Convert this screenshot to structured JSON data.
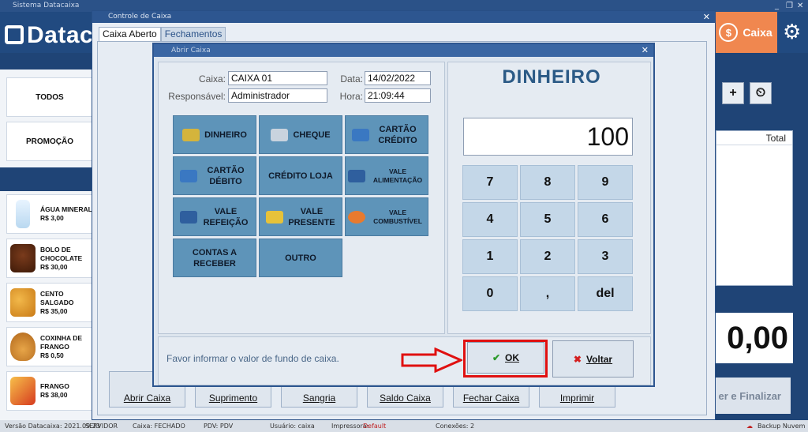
{
  "window": {
    "title": "Sistema Datacaixa"
  },
  "header": {
    "logo": "Datac",
    "caixa_label": "Caixa",
    "caixa_icon": "dollar-coin-icon",
    "settings_icon": "gear-icon",
    "accent": "#f0874f"
  },
  "sidebar": {
    "categories": [
      "TODOS",
      "PROMOÇÃO"
    ],
    "products": [
      {
        "name": "ÁGUA MINERAL",
        "price": "R$ 3,00"
      },
      {
        "name": "BOLO DE CHOCOLATE",
        "price": "R$ 30,00"
      },
      {
        "name": "CENTO SALGADO",
        "price": "R$ 35,00"
      },
      {
        "name": "COXINHA DE FRANGO",
        "price": "R$ 0,50"
      },
      {
        "name": "FRANGO",
        "price": "R$ 38,00"
      }
    ]
  },
  "right_panel": {
    "total_header": "Total",
    "total_value": "0,00",
    "finalize_label": "er e Finalizar",
    "add_label": "+",
    "scale_icon": "scale-icon"
  },
  "controle": {
    "title": "Controle de Caixa",
    "tabs": [
      "Caixa Aberto",
      "Fechamentos"
    ],
    "footer_buttons": [
      "Abrir Caixa",
      "Suprimento",
      "Sangria",
      "Saldo Caixa",
      "Fechar Caixa",
      "Imprimir"
    ]
  },
  "abrir": {
    "title": "Abrir Caixa",
    "fields": {
      "caixa_label": "Caixa:",
      "caixa_value": "CAIXA 01",
      "data_label": "Data:",
      "data_value": "14/02/2022",
      "responsavel_label": "Responsável:",
      "responsavel_value": "Administrador",
      "hora_label": "Hora:",
      "hora_value": "21:09:44"
    },
    "payment_methods": [
      "DINHEIRO",
      "CHEQUE",
      "CARTÃO CRÉDITO",
      "CARTÃO DÉBITO",
      "CRÉDITO LOJA",
      "VALE ALIMENTAÇÃO",
      "VALE REFEIÇÃO",
      "VALE PRESENTE",
      "VALE COMBUSTÍVEL",
      "CONTAS A RECEBER",
      "OUTRO"
    ],
    "selected_method": "DINHEIRO",
    "amount": "100",
    "keypad": [
      "7",
      "8",
      "9",
      "4",
      "5",
      "6",
      "1",
      "2",
      "3",
      "0",
      ",",
      "del"
    ],
    "note": "Favor informar o valor de fundo de caixa.",
    "ok_label": "OK",
    "cancel_label": "Voltar",
    "highlight_color": "#e01010"
  },
  "status_bar": {
    "version": "Versão Datacaixa: 2021.09.23",
    "server": "SERVIDOR",
    "caixa": "Caixa: FECHADO",
    "pdv": "PDV: PDV",
    "usuario": "Usuário: caixa",
    "impressora_label": "Impressora:",
    "impressora_value": "Default",
    "conexoes": "Conexões: 2",
    "backup": "Backup Nuvem"
  }
}
